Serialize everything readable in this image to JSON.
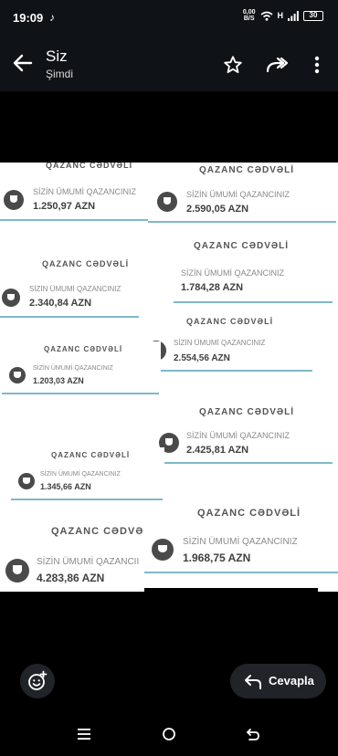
{
  "status": {
    "time": "19:09",
    "speed_top": "0,00",
    "speed_bottom": "B/S",
    "network": "H",
    "battery": "30"
  },
  "header": {
    "title": "Siz",
    "subtitle": "Şimdi"
  },
  "cards": [
    {
      "head": "QAZANC CƏDVƏLİ",
      "label": "SİZİN ÜMUMİ QAZANCINIZ",
      "amount": "1.250,97 AZN"
    },
    {
      "head": "QAZANC CƏDVƏLİ",
      "label": "SİZİN ÜMUMİ QAZANCINIZ",
      "amount": "2.590,05 AZN"
    },
    {
      "head": "QAZANC CƏDVƏLİ",
      "label": "SİZİN ÜMUMİ QAZANCINIZ",
      "amount": "1.784,28 AZN"
    },
    {
      "head": "QAZANC CƏDVƏLİ",
      "label": "SİZİN ÜMUMİ QAZANCINIZ",
      "amount": "2.340,84 AZN"
    },
    {
      "head": "QAZANC CƏDVƏLİ",
      "label": "SİZİN ÜMUMİ QAZANCINIZ",
      "amount": "2.554,56 AZN"
    },
    {
      "head": "QAZANC CƏDVƏLİ",
      "label": "SİZİN ÜMUMİ QAZANCINIZ",
      "amount": "1.203,03 AZN"
    },
    {
      "head": "QAZANC CƏDVƏLİ",
      "label": "SİZİN ÜMUMİ QAZANCINIZ",
      "amount": "2.425,81 AZN"
    },
    {
      "head": "QAZANC CƏDVƏLİ",
      "label": "SİZİN ÜMUMİ QAZANCINIZ",
      "amount": "1.345,66 AZN"
    },
    {
      "head": "QAZANC CƏDVƏLİ",
      "label": "SİZİN ÜMUMİ QAZANCINIZ",
      "amount": "1.968,75 AZN"
    },
    {
      "head": "QAZANC CƏDVƏ",
      "label": "SİZİN ÜMUMİ QAZANCII",
      "amount": "4.283,86 AZN"
    }
  ],
  "reply": {
    "label": "Cevapla"
  },
  "colors": {
    "accent_line": "#7fb8c9",
    "trophy": "#4a4a4a",
    "pill": "#202429"
  }
}
